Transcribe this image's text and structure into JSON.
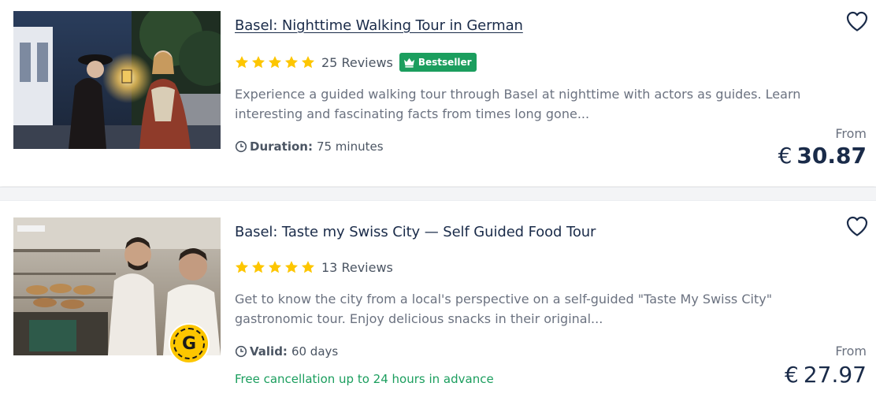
{
  "listings": [
    {
      "title": "Basel: Nighttime Walking Tour in German",
      "rating": 5,
      "reviews": "25 Reviews",
      "badge": "Bestseller",
      "description": "Experience a guided walking tour through Basel at nighttime with actors as guides. Learn interesting and fascinating facts from times long gone...",
      "meta_label": "Duration:",
      "meta_value": "75 minutes",
      "price_prefix": "From",
      "currency": "€",
      "price": "30.87"
    },
    {
      "title": "Basel: Taste my Swiss City — Self Guided Food Tour",
      "rating": 5,
      "reviews": "13 Reviews",
      "description": "Get to know the city from a local's perspective on a self-guided \"Taste My Swiss City\" gastronomic tour. Enjoy delicious snacks in their original...",
      "meta_label": "Valid:",
      "meta_value": "60 days",
      "cancellation": "Free cancellation up to 24 hours in advance",
      "provider_badge": "G",
      "price_prefix": "From",
      "currency": "€",
      "price": "27.97"
    }
  ],
  "colors": {
    "title": "#1a2b49",
    "star": "#fdc600",
    "bestseller_bg": "#1b9e5e",
    "cancellation": "#1b9e5e",
    "muted_text": "#6b7280"
  },
  "icons": [
    "star-icon",
    "crown-icon",
    "clock-icon",
    "heart-icon"
  ]
}
